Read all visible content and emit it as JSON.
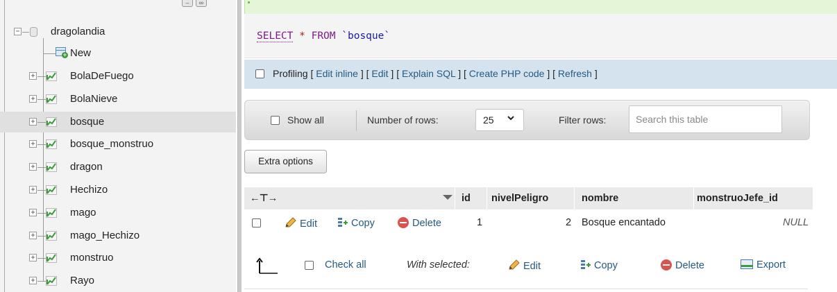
{
  "nav": {
    "database": "dragolandia",
    "new_label": "New",
    "tables": [
      "BolaDeFuego",
      "BolaNieve",
      "bosque",
      "bosque_monstruo",
      "dragon",
      "Hechizo",
      "mago",
      "mago_Hechizo",
      "monstruo",
      "Rayo"
    ],
    "selected_table": "bosque"
  },
  "query": {
    "select": "SELECT",
    "star": "*",
    "from": "FROM",
    "table": "`bosque`"
  },
  "profiling": {
    "label": "Profiling",
    "links": [
      "Edit inline",
      "Edit",
      "Explain SQL",
      "Create PHP code",
      "Refresh"
    ]
  },
  "filter": {
    "show_all": "Show all",
    "number_of_rows": "Number of rows:",
    "rows_value": "25",
    "filter_rows": "Filter rows:",
    "search_placeholder": "Search this table"
  },
  "extra_options": "Extra options",
  "table": {
    "columns": [
      "id",
      "nivelPeligro",
      "nombre",
      "monstruoJefe_id"
    ],
    "row_actions": {
      "edit": "Edit",
      "copy": "Copy",
      "delete": "Delete"
    },
    "rows": [
      {
        "id": "1",
        "nivelPeligro": "2",
        "nombre": "Bosque encantado",
        "monstruoJefe_id": "NULL"
      }
    ]
  },
  "bottom": {
    "check_all": "Check all",
    "with_selected": "With selected:",
    "edit": "Edit",
    "copy": "Copy",
    "delete": "Delete",
    "export": "Export"
  },
  "colors": {
    "link": "#235a81",
    "keyword": "#80188b",
    "delete": "#d9534f"
  }
}
